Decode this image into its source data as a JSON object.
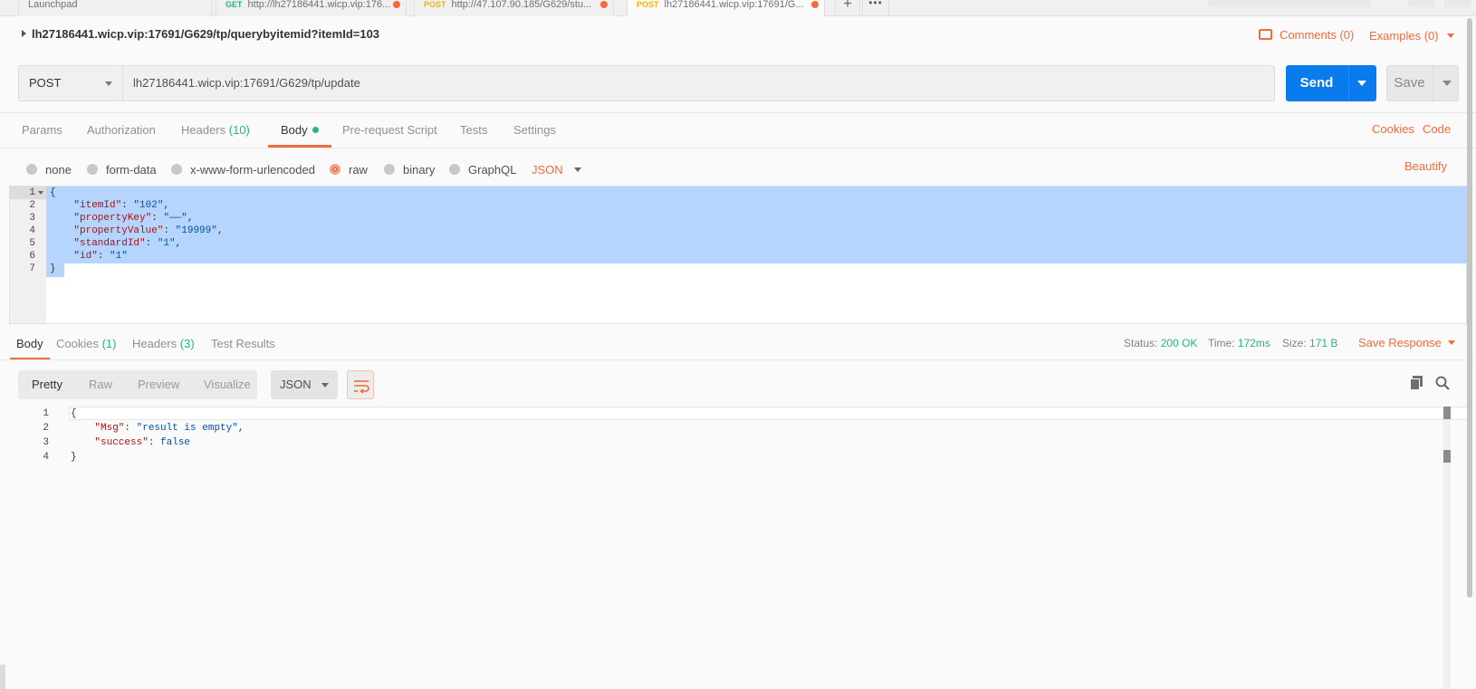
{
  "tabs": [
    {
      "method": "",
      "title": "Launchpad"
    },
    {
      "method": "GET",
      "title": "http://lh27186441.wicp.vip:176...",
      "method_color": "#26b47f"
    },
    {
      "method": "POST",
      "title": "http://47.107.90.185/G629/stu...",
      "method_color": "#f4b400"
    },
    {
      "method": "POST",
      "title": "lh27186441.wicp.vip:17691/G...",
      "method_color": "#f4b400"
    }
  ],
  "request": {
    "name": "lh27186441.wicp.vip:17691/G629/tp/querybyitemid?itemId=103",
    "comments": "Comments (0)",
    "examples": "Examples (0)",
    "method": "POST",
    "url": "lh27186441.wicp.vip:17691/G629/tp/update",
    "send": "Send",
    "save": "Save"
  },
  "request_tabs": {
    "params": "Params",
    "authorization": "Authorization",
    "headers": "Headers",
    "headers_count": "(10)",
    "body": "Body",
    "prerequest": "Pre-request Script",
    "tests": "Tests",
    "settings": "Settings",
    "cookies": "Cookies",
    "code": "Code"
  },
  "body_types": {
    "none": "none",
    "form_data": "form-data",
    "urlencoded": "x-www-form-urlencoded",
    "raw": "raw",
    "binary": "binary",
    "graphql": "GraphQL",
    "selected": "raw",
    "format": "JSON",
    "beautify": "Beautify"
  },
  "request_body": {
    "line_numbers": [
      "1",
      "2",
      "3",
      "4",
      "5",
      "6",
      "7"
    ],
    "open": "{",
    "close": "}",
    "fields": [
      {
        "key": "\"itemId\"",
        "value": "\"102\"",
        "sep": ","
      },
      {
        "key": "\"propertyKey\"",
        "value": "\"——\"",
        "sep": ","
      },
      {
        "key": "\"propertyValue\"",
        "value": "\"19999\"",
        "sep": ","
      },
      {
        "key": "\"standardId\"",
        "value": "\"1\"",
        "sep": ","
      },
      {
        "key": "\"id\"",
        "value": "\"1\"",
        "sep": ""
      }
    ]
  },
  "response_tabs": {
    "body": "Body",
    "cookies": "Cookies",
    "cookies_count": "(1)",
    "headers": "Headers",
    "headers_count": "(3)",
    "test_results": "Test Results"
  },
  "response_status": {
    "status_label": "Status:",
    "status_value": "200 OK",
    "time_label": "Time:",
    "time_value": "172ms",
    "size_label": "Size:",
    "size_value": "171 B",
    "save_response": "Save Response"
  },
  "response_view": {
    "pretty": "Pretty",
    "raw": "Raw",
    "preview": "Preview",
    "visualize": "Visualize",
    "format": "JSON"
  },
  "response_body": {
    "line_numbers": [
      "1",
      "2",
      "3",
      "4"
    ],
    "open": "{",
    "close": "}",
    "msg_key": "\"Msg\"",
    "msg_value": "\"result is empty\"",
    "success_key": "\"success\"",
    "success_value": "false"
  },
  "colors": {
    "accent": "#f26b3a",
    "send_blue": "#097bed",
    "status_green": "#26b47f",
    "selection": "#b5d5ff"
  }
}
